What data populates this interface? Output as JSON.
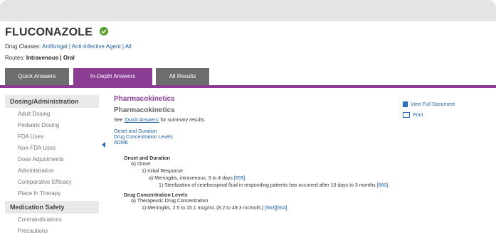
{
  "drug": {
    "name": "FLUCONAZOLE",
    "classes_label": "Drug Classes:",
    "classes": [
      "Antifungal |",
      "Anti-Infective Agent |",
      "All"
    ],
    "routes_label": "Routes:",
    "routes_value": "Intravenous | Oral"
  },
  "tabs": [
    {
      "label": "Quick Answers"
    },
    {
      "label": "In-Depth Answers"
    },
    {
      "label": "All Results"
    }
  ],
  "sidebar": {
    "sections": [
      {
        "title": "Dosing/Administration",
        "items": [
          "Adult Dosing",
          "Pediatric Dosing",
          "FDA Uses",
          "Non-FDA Uses",
          "Dose Adjustments",
          "Administration",
          "Comparative Efficacy",
          "Place In Therapy"
        ]
      },
      {
        "title": "Medication Safety",
        "items": [
          "Contraindications",
          "Precautions"
        ]
      }
    ]
  },
  "content": {
    "title": "Pharmacokinetics",
    "subtitle": "Pharmacokinetics",
    "see_prefix": "See ",
    "see_link": "'Quick Answers'",
    "see_suffix": " for summary results.",
    "toc": [
      "Onset and Duration",
      "Drug Concentration Levels",
      "ADME"
    ],
    "outline": {
      "h1": "Onset and Duration",
      "a": "A) Onset",
      "a1": "1) Initial Response",
      "a1a": "a) Meningitis, intravenous: 3 to 4 days",
      "a1a_ref": "[659].",
      "a1a1": "1) Sterilization of cerebrospinal fluid in responding patients has occurred after 10 days to 3 months",
      "a1a1_ref": "[660].",
      "h2": "Drug Concentration Levels",
      "b": "A) Therapeutic Drug Concentration",
      "b1": "1) Meningitis, 2.5 to 15.1 mcg/mL (8.2 to 49.3 mcmol/L)",
      "b1_ref": "[663][664]."
    },
    "actions": [
      "View Full Document",
      "Print"
    ]
  }
}
